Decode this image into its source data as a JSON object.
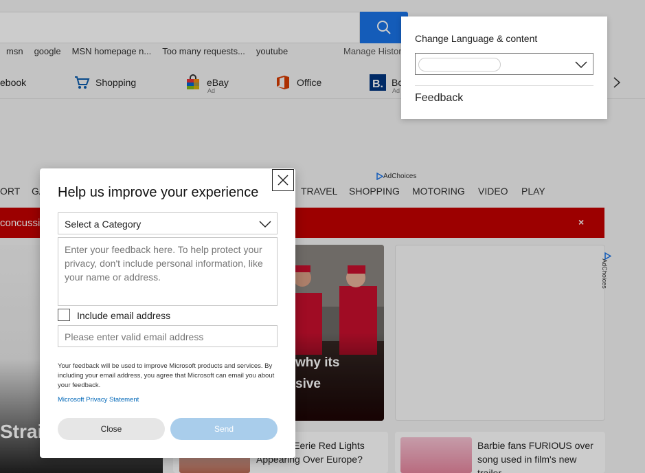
{
  "quicklinks": [
    "msn",
    "google",
    "MSN homepage n...",
    "Too many requests...",
    "youtube"
  ],
  "manage_history": "Manage Histor",
  "tiles": [
    {
      "label": "ebook",
      "ad": ""
    },
    {
      "label": "Shopping",
      "ad": ""
    },
    {
      "label": "eBay",
      "ad": "Ad"
    },
    {
      "label": "Office",
      "ad": ""
    },
    {
      "label": "Bo",
      "ad": "Ad"
    }
  ],
  "adchoices_label": "AdChoices",
  "nav_items": [
    "ORT",
    "GA",
    "TRAVEL",
    "SHOPPING",
    "MOTORING",
    "VIDEO",
    "PLAY"
  ],
  "banner": {
    "text": "concussio",
    "close": "×"
  },
  "cards": {
    "left_text": "Strait",
    "photo_text_line1": "why its",
    "photo_text_line2": "sive",
    "bottom1_title": "e These Eerie Red Lights Appearing Over Europe?",
    "bottom2_title": "Barbie fans FURIOUS over song used in film's new trailer"
  },
  "flyout": {
    "label": "Change Language & content",
    "feedback": "Feedback"
  },
  "dialog": {
    "title": "Help us improve your experience",
    "category_placeholder": "Select a Category",
    "feedback_placeholder": "Enter your feedback here. To help protect your privacy, don't include personal information, like your name or address.",
    "email_checkbox_label": "Include email address",
    "email_placeholder": "Please enter valid email address",
    "disclaimer": "Your feedback will be used to improve Microsoft products and services. By including your email address, you agree that Microsoft can email you about your feedback.",
    "privacy_link": "Microsoft Privacy Statement",
    "close_button": "Close",
    "send_button": "Send"
  },
  "colors": {
    "accent": "#1a73e8",
    "banner": "#c40000",
    "link": "#0067b8",
    "send_disabled": "#a9cdeb"
  }
}
